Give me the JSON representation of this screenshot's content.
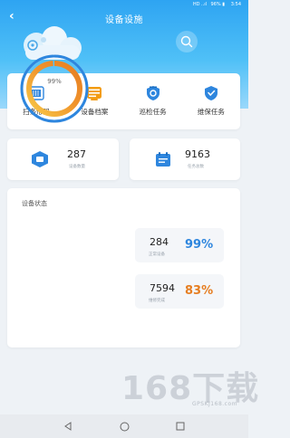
{
  "status_bar": {
    "signal": "HD ..ıl",
    "battery": "96% ▮",
    "time": "3:54"
  },
  "header": {
    "title": "设备设施"
  },
  "quick_menu": [
    {
      "label": "扫条形码",
      "icon": "barcode-scan-icon",
      "color": "#2e86de"
    },
    {
      "label": "设备档案",
      "icon": "archive-icon",
      "color": "#f39c12"
    },
    {
      "label": "巡检任务",
      "icon": "inspection-shield-icon",
      "color": "#2e86de"
    },
    {
      "label": "维保任务",
      "icon": "maintenance-shield-icon",
      "color": "#2e86de"
    }
  ],
  "stats": {
    "equipment": {
      "value": "287",
      "label": "设备数量"
    },
    "tasks": {
      "value": "9163",
      "label": "任务总数"
    }
  },
  "equipment_status": {
    "title": "设备状态",
    "ring_percent_label": "99%",
    "ring_fraction": 0.99,
    "normal": {
      "count": "284",
      "label": "正常设备",
      "percent": "99%",
      "color": "#2e86de"
    },
    "abnormal": {
      "count": "7594",
      "label": "维修完成",
      "percent": "83%",
      "color": "#e67e22"
    }
  },
  "watermark": {
    "big": "168下载",
    "small": "GPSKJ168.com"
  },
  "nav": {
    "back": "back-nav-icon",
    "home": "home-nav-icon",
    "recent": "recent-apps-icon"
  }
}
